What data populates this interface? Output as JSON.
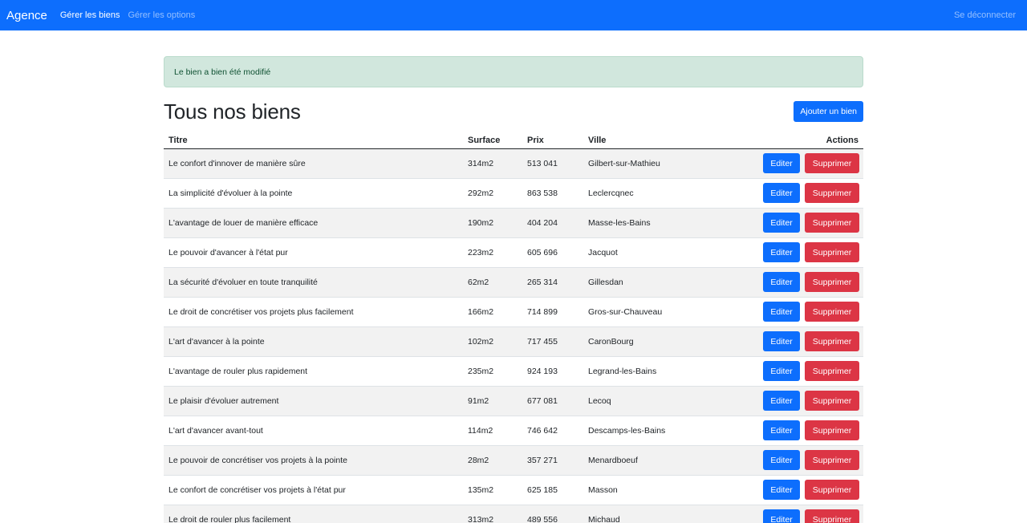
{
  "navbar": {
    "brand": "Agence",
    "links": [
      "Gérer les biens",
      "Gérer les options"
    ],
    "logout": "Se déconnecter"
  },
  "alert": {
    "message": "Le bien a bien été modifié"
  },
  "page": {
    "title": "Tous nos biens",
    "add_label": "Ajouter un bien"
  },
  "table": {
    "headers": {
      "titre": "Titre",
      "surface": "Surface",
      "prix": "Prix",
      "ville": "Ville",
      "actions": "Actions"
    },
    "edit_label": "Editer",
    "delete_label": "Supprimer",
    "rows": [
      {
        "titre": "Le confort d'innover de manière sûre",
        "surface": "314m2",
        "prix": "513 041",
        "ville": "Gilbert-sur-Mathieu"
      },
      {
        "titre": "La simplicité d'évoluer à la pointe",
        "surface": "292m2",
        "prix": "863 538",
        "ville": "Leclercqnec"
      },
      {
        "titre": "L'avantage de louer de manière efficace",
        "surface": "190m2",
        "prix": "404 204",
        "ville": "Masse-les-Bains"
      },
      {
        "titre": "Le pouvoir d'avancer à l'état pur",
        "surface": "223m2",
        "prix": "605 696",
        "ville": "Jacquot"
      },
      {
        "titre": "La sécurité d'évoluer en toute tranquilité",
        "surface": "62m2",
        "prix": "265 314",
        "ville": "Gillesdan"
      },
      {
        "titre": "Le droit de concrétiser vos projets plus facilement",
        "surface": "166m2",
        "prix": "714 899",
        "ville": "Gros-sur-Chauveau"
      },
      {
        "titre": "L'art d'avancer à la pointe",
        "surface": "102m2",
        "prix": "717 455",
        "ville": "CaronBourg"
      },
      {
        "titre": "L'avantage de rouler plus rapidement",
        "surface": "235m2",
        "prix": "924 193",
        "ville": "Legrand-les-Bains"
      },
      {
        "titre": "Le plaisir d'évoluer autrement",
        "surface": "91m2",
        "prix": "677 081",
        "ville": "Lecoq"
      },
      {
        "titre": "L'art d'avancer avant-tout",
        "surface": "114m2",
        "prix": "746 642",
        "ville": "Descamps-les-Bains"
      },
      {
        "titre": "Le pouvoir de concrétiser vos projets à la pointe",
        "surface": "28m2",
        "prix": "357 271",
        "ville": "Menardboeuf"
      },
      {
        "titre": "Le confort de concrétiser vos projets à l'état pur",
        "surface": "135m2",
        "prix": "625 185",
        "ville": "Masson"
      },
      {
        "titre": "Le droit de rouler plus facilement",
        "surface": "313m2",
        "prix": "489 556",
        "ville": "Michaud"
      }
    ]
  }
}
